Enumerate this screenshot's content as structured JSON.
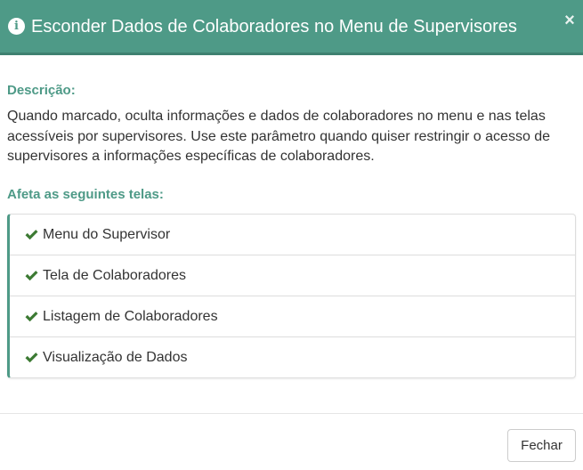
{
  "dialog": {
    "title": "Esconder Dados de Colaboradores no Menu de Supervisores",
    "close_icon": "×",
    "info_icon": "i"
  },
  "description": {
    "label": "Descrição:",
    "text": "Quando marcado, oculta informações e dados de colaboradores no menu e nas telas acessíveis por supervisores. Use este parâmetro quando quiser restringir o acesso de supervisores a informações específicas de colaboradores."
  },
  "affects": {
    "label": "Afeta as seguintes telas:",
    "items": [
      "Menu do Supervisor",
      "Tela de Colaboradores",
      "Listagem de Colaboradores",
      "Visualização de Dados"
    ]
  },
  "footer": {
    "close_label": "Fechar"
  },
  "colors": {
    "header_bg": "#4e9a87",
    "accent": "#4e9a87",
    "check": "#3c7a33"
  }
}
